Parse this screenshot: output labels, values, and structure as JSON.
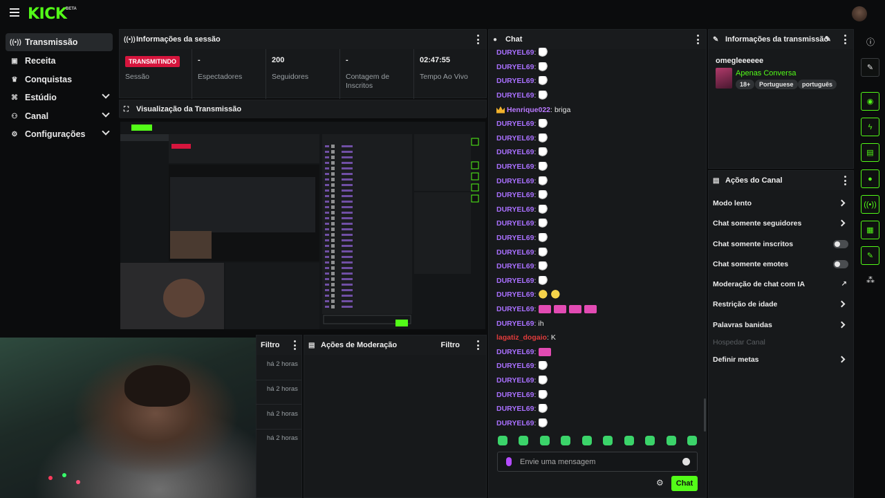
{
  "app": {
    "logo": "KICK",
    "logo_badge": "BETA"
  },
  "nav": {
    "items": [
      {
        "label": "Transmissão",
        "icon": "broadcast-icon",
        "active": true,
        "chevron": false
      },
      {
        "label": "Receita",
        "icon": "revenue-icon",
        "active": false,
        "chevron": false
      },
      {
        "label": "Conquistas",
        "icon": "trophy-icon",
        "active": false,
        "chevron": false
      },
      {
        "label": "Estúdio",
        "icon": "studio-icon",
        "active": false,
        "chevron": true
      },
      {
        "label": "Canal",
        "icon": "channel-icon",
        "active": false,
        "chevron": true
      },
      {
        "label": "Configurações",
        "icon": "gear-icon",
        "active": false,
        "chevron": true
      }
    ]
  },
  "session": {
    "title": "Informações da sessão",
    "live_badge": "TRANSMITINDO",
    "session_label": "Sessão",
    "stats": [
      {
        "value": "-",
        "label": "Espectadores"
      },
      {
        "value": "200",
        "label": "Seguidores"
      },
      {
        "value": "-",
        "label": "Contagem de Inscritos"
      },
      {
        "value": "02:47:55",
        "label": "Tempo Ao Vivo"
      }
    ]
  },
  "preview": {
    "title": "Visualização da Transmissão"
  },
  "lower": {
    "filter_label": "Filtro",
    "times": [
      "há 2 horas",
      "há 2 horas",
      "há 2 horas",
      "há 2 horas"
    ],
    "mod_title": "Ações de Moderação",
    "mod_filter": "Filtro"
  },
  "chat": {
    "title": "Chat",
    "messages": [
      {
        "user": "DURYEL69",
        "text": "",
        "emotes": [
          "goose"
        ]
      },
      {
        "user": "DURYEL69",
        "text": "",
        "emotes": [
          "goose"
        ]
      },
      {
        "user": "DURYEL69",
        "text": "",
        "emotes": [
          "goose"
        ]
      },
      {
        "user": "DURYEL69",
        "text": "",
        "emotes": [
          "goose"
        ]
      },
      {
        "user": "Henrique022",
        "text": "briga",
        "emotes": [],
        "badge": "crown",
        "color": "purple2"
      },
      {
        "user": "DURYEL69",
        "text": "",
        "emotes": [
          "goose"
        ]
      },
      {
        "user": "DURYEL69",
        "text": "",
        "emotes": [
          "goose"
        ]
      },
      {
        "user": "DURYEL69",
        "text": "",
        "emotes": [
          "goose"
        ]
      },
      {
        "user": "DURYEL69",
        "text": "",
        "emotes": [
          "goose"
        ]
      },
      {
        "user": "DURYEL69",
        "text": "",
        "emotes": [
          "goose"
        ]
      },
      {
        "user": "DURYEL69",
        "text": "",
        "emotes": [
          "goose"
        ]
      },
      {
        "user": "DURYEL69",
        "text": "",
        "emotes": [
          "goose"
        ]
      },
      {
        "user": "DURYEL69",
        "text": "",
        "emotes": [
          "goose"
        ]
      },
      {
        "user": "DURYEL69",
        "text": "",
        "emotes": [
          "goose"
        ]
      },
      {
        "user": "DURYEL69",
        "text": "",
        "emotes": [
          "goose"
        ]
      },
      {
        "user": "DURYEL69",
        "text": "",
        "emotes": [
          "goose"
        ]
      },
      {
        "user": "DURYEL69",
        "text": "",
        "emotes": [
          "goose"
        ]
      },
      {
        "user": "DURYEL69",
        "text": "",
        "emotes": [
          "pac",
          "pac"
        ]
      },
      {
        "user": "DURYEL69",
        "text": "",
        "emotes": [
          "pink",
          "pink",
          "pink",
          "pink"
        ]
      },
      {
        "user": "DURYEL69",
        "text": "ih",
        "emotes": []
      },
      {
        "user": "lagatiz_dogaio",
        "text": "K",
        "emotes": [],
        "color": "red"
      },
      {
        "user": "DURYEL69",
        "text": "",
        "emotes": [
          "pink"
        ]
      },
      {
        "user": "DURYEL69",
        "text": "",
        "emotes": [
          "goose"
        ]
      },
      {
        "user": "DURYEL69",
        "text": "",
        "emotes": [
          "goose"
        ]
      },
      {
        "user": "DURYEL69",
        "text": "",
        "emotes": [
          "goose"
        ]
      },
      {
        "user": "DURYEL69",
        "text": "",
        "emotes": [
          "goose"
        ]
      },
      {
        "user": "DURYEL69",
        "text": "",
        "emotes": [
          "goose"
        ]
      }
    ],
    "input_placeholder": "Envie uma mensagem",
    "send_label": "Chat"
  },
  "broadcast_info": {
    "title": "Informações da transmissão",
    "stream_title": "omegleeeeee",
    "category": "Apenas Conversa",
    "tags": [
      "18+",
      "Portuguese",
      "português"
    ]
  },
  "channel_actions": {
    "title": "Ações do Canal",
    "items": [
      {
        "label": "Modo lento",
        "control": "chevron"
      },
      {
        "label": "Chat somente seguidores",
        "control": "chevron"
      },
      {
        "label": "Chat somente inscritos",
        "control": "toggle"
      },
      {
        "label": "Chat somente emotes",
        "control": "toggle"
      },
      {
        "label": "Moderação de chat com IA",
        "control": "external"
      },
      {
        "label": "Restrição de idade",
        "control": "chevron"
      },
      {
        "label": "Palavras banidas",
        "control": "chevron"
      },
      {
        "label": "Hospedar Canal",
        "control": "disabled"
      },
      {
        "label": "Definir metas",
        "control": "chevron"
      }
    ]
  },
  "colors": {
    "accent": "#53fc18",
    "live": "#d6153d",
    "username": "#a970ff",
    "panel": "#17191b"
  }
}
